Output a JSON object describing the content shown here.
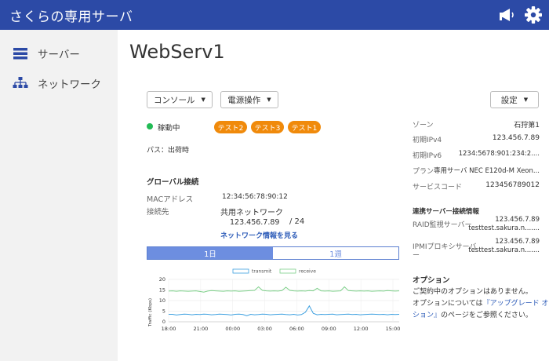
{
  "header": {
    "title": "さくらの専用サーバ",
    "announce_icon": "megaphone-icon",
    "settings_icon": "gear-icon"
  },
  "sidebar": {
    "items": [
      {
        "label": "サーバー",
        "icon": "server-list-icon"
      },
      {
        "label": "ネットワーク",
        "icon": "network-tree-icon"
      }
    ]
  },
  "server": {
    "name": "WebServ1",
    "console_label": "コンソール",
    "power_label": "電源操作",
    "settings_label": "設定",
    "status": "稼動中",
    "status_color": "#22bb55",
    "tags": [
      "テスト2",
      "テスト3",
      "テスト1"
    ],
    "path": "パス：出荷時"
  },
  "global": {
    "heading": "グローバル接続",
    "mac_label": "MACアドレス",
    "mac_value": "12:34:56:78:90:12",
    "conn_label": "接続先",
    "conn_value": "共用ネットワーク",
    "ip": "123.456.7.89",
    "prefix": "/ 24",
    "network_link": "ネットワーク情報を見る"
  },
  "tabs": [
    {
      "label": "1日"
    },
    {
      "label": "1週"
    }
  ],
  "chart_data": {
    "type": "line",
    "ylabel": "Traffic (Kbps)",
    "ylim": [
      0,
      20
    ],
    "yticks": [
      "20",
      "15",
      "10",
      "5",
      "0"
    ],
    "xticks": [
      "18:00",
      "21:00",
      "00:00",
      "03:00",
      "06:00",
      "09:00",
      "12:00",
      "15:00"
    ],
    "series": [
      {
        "name": "transmit",
        "color": "#3da0e0",
        "values": [
          3.5,
          3.5,
          3.2,
          3.4,
          3.6,
          3.5,
          3.3,
          3.5,
          3.4,
          3.6,
          3.5,
          3.3,
          3.4,
          3.6,
          3.5,
          3.4,
          3.2,
          3.5,
          3.6,
          3.4,
          2.8,
          3.5,
          3.3,
          3.4,
          3.6,
          3.5,
          3.3,
          3.4,
          3.5,
          3.6,
          3.4,
          3.3,
          3.5,
          3.2,
          3.4,
          4.5,
          7.5,
          4.0,
          3.3,
          3.5,
          3.4,
          3.5,
          3.6,
          3.3,
          3.4,
          3.5,
          3.6,
          3.4,
          3.5,
          3.3,
          3.4,
          3.5,
          3.6,
          3.5,
          3.4,
          3.5,
          3.3,
          3.5,
          3.4,
          3.5
        ]
      },
      {
        "name": "receive",
        "color": "#7ed08a",
        "values": [
          14.5,
          14.6,
          14.4,
          14.6,
          14.5,
          14.4,
          14.5,
          14.6,
          14.3,
          14.0,
          14.5,
          14.7,
          14.6,
          14.5,
          14.4,
          14.6,
          14.5,
          14.6,
          14.4,
          14.5,
          14.6,
          14.7,
          14.8,
          16.5,
          14.8,
          14.6,
          14.5,
          14.6,
          14.5,
          14.7,
          16.3,
          14.8,
          14.6,
          14.5,
          14.6,
          14.5,
          14.7,
          14.6,
          15.8,
          14.6,
          14.5,
          14.6,
          14.4,
          14.5,
          14.6,
          16.5,
          14.7,
          14.6,
          14.5,
          14.6,
          14.5,
          14.6,
          14.4,
          14.5,
          14.6,
          14.5,
          14.7,
          14.6,
          14.5,
          14.6
        ]
      }
    ]
  },
  "details": {
    "zone_label": "ゾーン",
    "zone_value": "石狩第1",
    "ipv4_label": "初期IPv4",
    "ipv4_value": "123.456.7.89",
    "ipv6_label": "初期IPv6",
    "ipv6_value": "1234:5678:901:234:2....",
    "plan_label": "プラン",
    "plan_value": "専用サーバ NEC E120d-M Xeon...",
    "code_label": "サービスコード",
    "code_value": "123456789012"
  },
  "linked": {
    "heading": "連携サーバー接続情報",
    "raid_label": "RAID監視サーバー",
    "raid_ip": "123.456.7.89",
    "raid_host": "testtest.sakura.n.......",
    "ipmi_label_1": "IPMIプロキシサーバ",
    "ipmi_label_2": "ー",
    "ipmi_ip": "123.456.7.89",
    "ipmi_host": "testtest.sakura.n......."
  },
  "options": {
    "heading": "オプション",
    "none_text": "ご契約中のオプションはありません。",
    "info_prefix": "オプションについては",
    "link_line1": "『アップグレード オプ",
    "link_line2": "ション』",
    "info_suffix": "のページをご参照ください。"
  }
}
